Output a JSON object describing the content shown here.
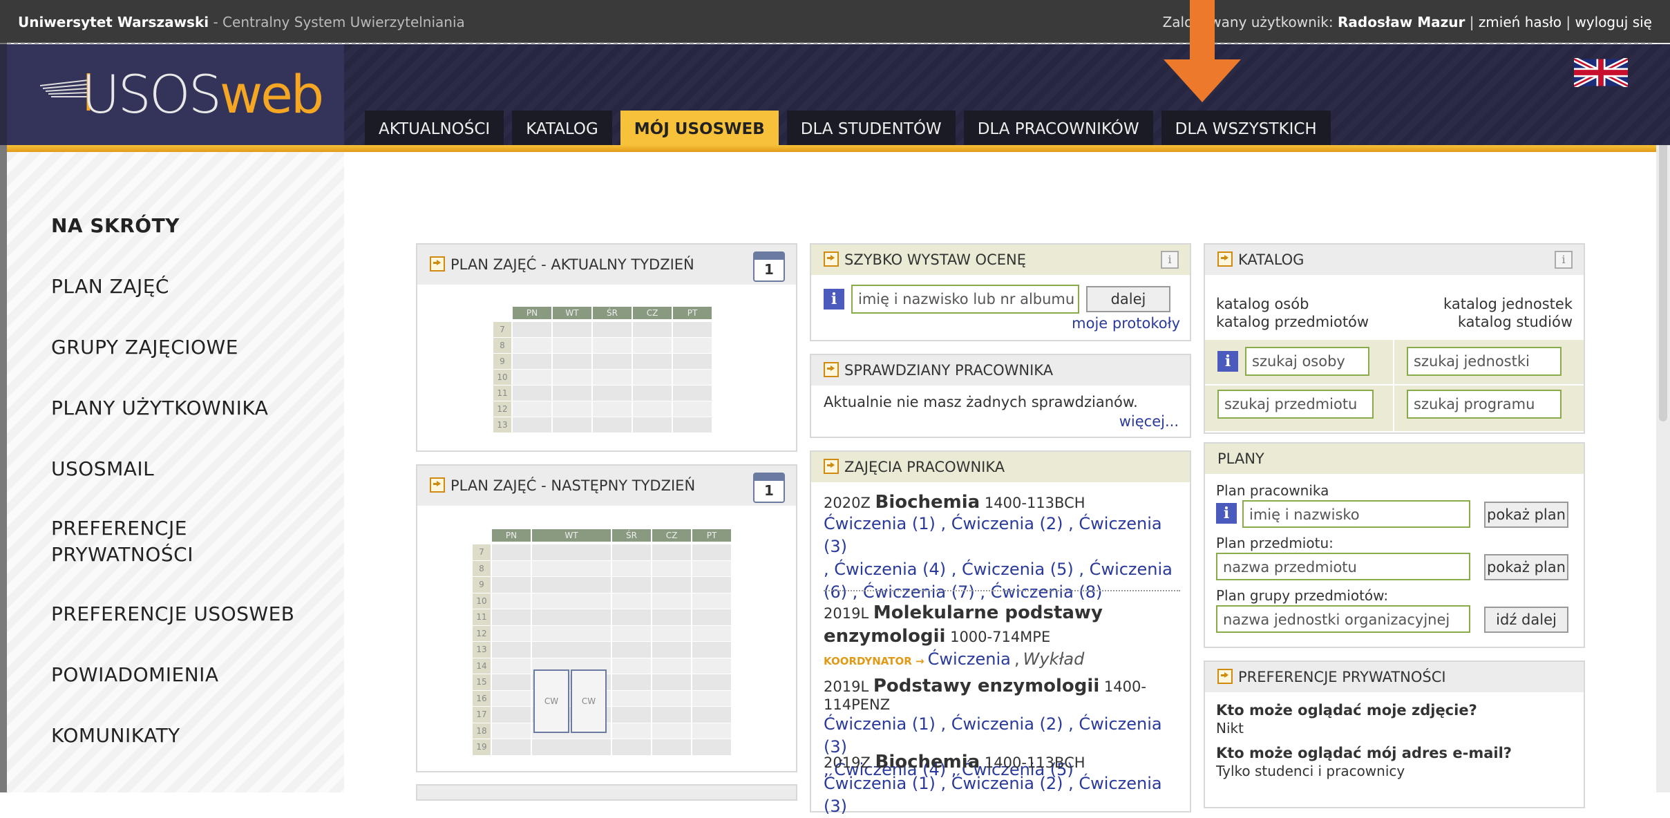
{
  "topbar": {
    "university": "Uniwersytet Warszawski",
    "system": " - Centralny System Uwierzytelniania",
    "logged_prefix": "Zalogowany użytkownik:",
    "user": "Radosław Mazur",
    "change_password": "zmień hasło",
    "logout": "wyloguj się",
    "sep": "|"
  },
  "logo": {
    "uso": "USOS",
    "web": "web"
  },
  "tabs": [
    "AKTUALNOŚCI",
    "KATALOG",
    "MÓJ USOSWEB",
    "DLA STUDENTÓW",
    "DLA PRACOWNIKÓW",
    "DLA WSZYSTKICH"
  ],
  "active_tab": "MÓJ USOSWEB",
  "sidebar": {
    "title": "NA SKRÓTY",
    "items": [
      "PLAN ZAJĘĆ",
      "GRUPY ZAJĘCIOWE",
      "PLANY UŻYTKOWNIKA",
      "USOSMAIL",
      "PREFERENCJE",
      "PRYWATNOŚCI",
      "PREFERENCJE USOSWEB",
      "POWIADOMIENIA",
      "KOMUNIKATY"
    ]
  },
  "plan_current": {
    "title": "PLAN ZAJĘĆ - AKTUALNY TYDZIEŃ",
    "calendar_day": "1",
    "days": [
      "PN",
      "WT",
      "ŚR",
      "CZ",
      "PT"
    ],
    "hours": [
      "7",
      "8",
      "9",
      "10",
      "11",
      "12",
      "13"
    ]
  },
  "plan_next": {
    "title": "PLAN ZAJĘĆ - NASTĘPNY TYDZIEŃ",
    "calendar_day": "1",
    "days": [
      "PN",
      "WT",
      "ŚR",
      "CZ",
      "PT"
    ],
    "hours": [
      "7",
      "8",
      "9",
      "10",
      "11",
      "12",
      "13",
      "14",
      "15",
      "16",
      "17",
      "18",
      "19"
    ],
    "blocks": [
      "CW",
      "CW"
    ]
  },
  "quick_grade": {
    "title": "SZYBKO WYSTAW OCENĘ",
    "info": "i",
    "placeholder": "imię i nazwisko lub nr albumu",
    "button": "dalej",
    "link": "moje protokoły"
  },
  "tests": {
    "title": "SPRAWDZIANY PRACOWNIKA",
    "text": "Aktualnie nie masz żadnych sprawdzianów.",
    "more": "więcej..."
  },
  "classes": {
    "title": "ZAJĘCIA PRACOWNIKA",
    "courses": [
      {
        "term": "2020Z",
        "name": "Biochemia",
        "code": "1400-113BCH",
        "line1": "Ćwiczenia (1) , Ćwiczenia (2) , Ćwiczenia (3)",
        "line2": ", Ćwiczenia (4) , Ćwiczenia (5) , Ćwiczenia",
        "line3": "(6) , Ćwiczenia (7) , Ćwiczenia (8)"
      },
      {
        "term": "2019L",
        "name1": "Molekularne podstawy",
        "name2": "enzymologii",
        "code": "1000-714MPE",
        "role": "KOORDYNATOR →",
        "link": "Ćwiczenia",
        "sep": ",",
        "lecture": "Wykład"
      },
      {
        "term": "2019L",
        "name": "Podstawy enzymologii",
        "code": "1400-114PENZ",
        "line1": "Ćwiczenia (1) , Ćwiczenia (2) , Ćwiczenia (3)",
        "line2": ", Ćwiczenia (4) , Ćwiczenia (5)"
      },
      {
        "term": "2019Z",
        "name": "Biochemia",
        "code": "1400-113BCH",
        "line1": "Ćwiczenia (1) , Ćwiczenia (2) , Ćwiczenia (3)"
      }
    ]
  },
  "catalog": {
    "title": "KATALOG",
    "info": "i",
    "persons": "katalog osób",
    "units": "katalog jednostek",
    "courses": "katalog przedmiotów",
    "studies": "katalog studiów",
    "search_person": "szukaj osoby",
    "search_unit": "szukaj jednostki",
    "search_course": "szukaj przedmiotu",
    "search_program": "szukaj programu"
  },
  "plans": {
    "title": "PLANY",
    "employee_label": "Plan pracownika",
    "employee_placeholder": "imię i nazwisko",
    "show_plan": "pokaż plan",
    "course_label": "Plan przedmiotu:",
    "course_placeholder": "nazwa przedmiotu",
    "group_label": "Plan grupy przedmiotów:",
    "group_placeholder": "nazwa jednostki organizacyjnej",
    "go": "idź dalej"
  },
  "privacy": {
    "title": "PREFERENCJE PRYWATNOŚCI",
    "q1": "Kto może oglądać moje zdjęcie?",
    "a1": "Nikt",
    "q2": "Kto może oglądać mój adres e-mail?",
    "a2": "Tylko studenci i pracownicy"
  },
  "colors": {
    "accent": "#f8c13a",
    "arrow": "#ec7a2a",
    "link": "#2a3a9a",
    "header": "#2b2b44"
  }
}
